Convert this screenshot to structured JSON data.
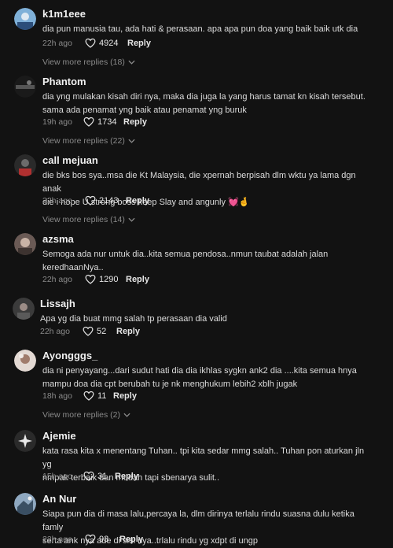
{
  "comments": [
    {
      "username": "k1m1eee",
      "text": "dia pun manusia tau, ada hati & perasaan. apa apa pun doa yang baik baik utk dia",
      "time": "22h ago",
      "likes": "4924",
      "reply_label": "Reply",
      "view_more": "View more replies (18)",
      "avatar_colors": [
        "#7fb0d8",
        "#2c4e7a"
      ]
    },
    {
      "username": "Phantom",
      "text": "dia yng mulakan kisah diri nya, maka dia juga la yang harus tamat kn kisah tersebut.\nsama ada penamat yng baik atau penamat yng buruk",
      "time": "19h ago",
      "likes": "1734",
      "reply_label": "Reply",
      "view_more": "View more replies (22)",
      "avatar_colors": [
        "#1a1a1a",
        "#555555"
      ]
    },
    {
      "username": "call mejuan",
      "text": "die bks bos sya..msa die Kt Malaysia, die xpernah berpisah dlm wktu ya lama dgn anak\ndie i hope U strong boss keep Slay and angunly",
      "emoji": [
        "💓",
        "🤞"
      ],
      "time": "22h ago",
      "likes": "2143",
      "reply_label": "Reply",
      "view_more": "View more replies (14)",
      "avatar_colors": [
        "#2a2a2a",
        "#b03030"
      ]
    },
    {
      "username": "azsma",
      "text": "Semoga ada nur untuk dia..kita semua pendosa..nmun taubat adalah jalan\nkeredhaanNya..",
      "time": "22h ago",
      "likes": "1290",
      "reply_label": "Reply",
      "avatar_colors": [
        "#6a5a55",
        "#c9b3a6"
      ]
    },
    {
      "username": "Lissajh",
      "text": "Apa yg dia buat mmg salah tp perasaan dia valid",
      "time": "22h ago",
      "likes": "52",
      "reply_label": "Reply",
      "avatar_colors": [
        "#3b3b3b",
        "#9b8c86"
      ]
    },
    {
      "username": "Ayongggs_",
      "text": "dia ni penyayang...dari sudut hati dia dia ikhlas sygkn ank2 dia ....kita semua hnya\nmampu doa dia cpt berubah tu je nk menghukum lebih2 xblh jugak",
      "time": "18h ago",
      "likes": "11",
      "reply_label": "Reply",
      "view_more": "View more replies (2)",
      "avatar_colors": [
        "#e3d9d3",
        "#a07c6c"
      ]
    },
    {
      "username": "Ajemie",
      "text": "kata rasa kita x menentang Tuhan.. tpi kita sedar mmg salah.. Tuhan pon aturkan jln yg\nnmpak terbaik dan mudah tapi sbenarya sulit..",
      "time": "15h ago",
      "likes": "31",
      "reply_label": "Reply",
      "avatar_colors": [
        "#2a2a2a",
        "#e8e8e8"
      ]
    },
    {
      "username": "An Nur",
      "text": "Siapa pun dia di masa lalu,percaya la, dlm dirinya terlalu rindu suasna dulu ketika famly\nserta ank nya ade di sisi nya..trlalu rindu yg xdpt di ungp",
      "time": "22h ago",
      "likes": "93",
      "reply_label": "Reply",
      "avatar_colors": [
        "#8fa8c0",
        "#3a4f63"
      ]
    }
  ]
}
